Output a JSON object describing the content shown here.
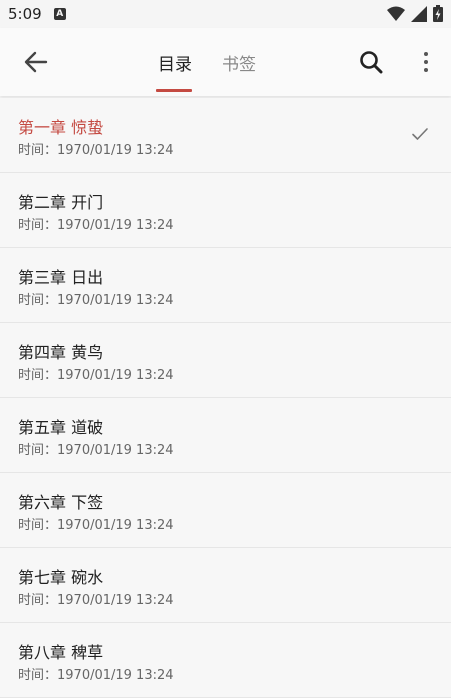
{
  "status_bar": {
    "time": "5:09",
    "notif_letter": "A"
  },
  "toolbar": {
    "tabs": [
      {
        "label": "目录",
        "active": true
      },
      {
        "label": "书签",
        "active": false
      }
    ]
  },
  "colors": {
    "accent": "#c44a42"
  },
  "chapters": [
    {
      "title": "第一章 惊蛰",
      "time": "时间：1970/01/19 13:24",
      "current": true
    },
    {
      "title": "第二章 开门",
      "time": "时间：1970/01/19 13:24",
      "current": false
    },
    {
      "title": "第三章 日出",
      "time": "时间：1970/01/19 13:24",
      "current": false
    },
    {
      "title": "第四章 黄鸟",
      "time": "时间：1970/01/19 13:24",
      "current": false
    },
    {
      "title": "第五章 道破",
      "time": "时间：1970/01/19 13:24",
      "current": false
    },
    {
      "title": "第六章 下签",
      "time": "时间：1970/01/19 13:24",
      "current": false
    },
    {
      "title": "第七章 碗水",
      "time": "时间：1970/01/19 13:24",
      "current": false
    },
    {
      "title": "第八章 稗草",
      "time": "时间：1970/01/19 13:24",
      "current": false
    }
  ]
}
